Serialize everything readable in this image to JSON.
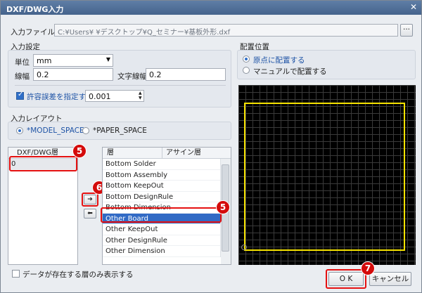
{
  "window": {
    "title": "DXF/DWG入力",
    "close_glyph": "✕"
  },
  "input_file": {
    "label": "入力ファイル",
    "value": "C:¥Users¥                ¥デスクトップ¥Q_セミナー¥基板外形.dxf",
    "browse_label": "···"
  },
  "input_settings": {
    "section_label": "入力設定",
    "unit_label": "単位",
    "unit_value": "mm",
    "line_width_label": "線幅",
    "line_width_value": "0.2",
    "text_width_label": "文字線幅",
    "text_width_value": "0.2",
    "tolerance_label": "許容誤差を指定する",
    "tolerance_checked": true,
    "tolerance_value": "0.001"
  },
  "placement": {
    "section_label": "配置位置",
    "option_origin": "原点に配置する",
    "option_manual": "マニュアルで配置する",
    "selected": "origin"
  },
  "input_layout": {
    "section_label": "入力レイアウト",
    "option_model": "*MODEL_SPACE",
    "option_paper": "*PAPER_SPACE",
    "selected": "model"
  },
  "dxf_layers": {
    "header": "DXF/DWG層",
    "items": [
      "0"
    ]
  },
  "arrows": {
    "assign": "➔",
    "unassign": "⬅"
  },
  "layer_table": {
    "col_layer": "層",
    "col_assign": "アサイン層",
    "rows": [
      "Bottom Solder",
      "Bottom Assembly",
      "Bottom KeepOut",
      "Bottom DesignRule",
      "Bottom Dimension",
      "Other Board",
      "Other KeepOut",
      "Other DesignRule",
      "Other Dimension"
    ],
    "selected_index": 5
  },
  "only_data_layers": {
    "label": "データが存在する層のみ表示する",
    "checked": false
  },
  "buttons": {
    "ok": "O K",
    "cancel": "キャンセル"
  },
  "badges": {
    "step5_left": "5",
    "step6": "6",
    "step5_right": "5",
    "step7": "7"
  },
  "colors": {
    "title_bar": "#4f6f9a",
    "selection": "#316ac5",
    "highlight": "#e51111",
    "outline": "#f5e200"
  }
}
